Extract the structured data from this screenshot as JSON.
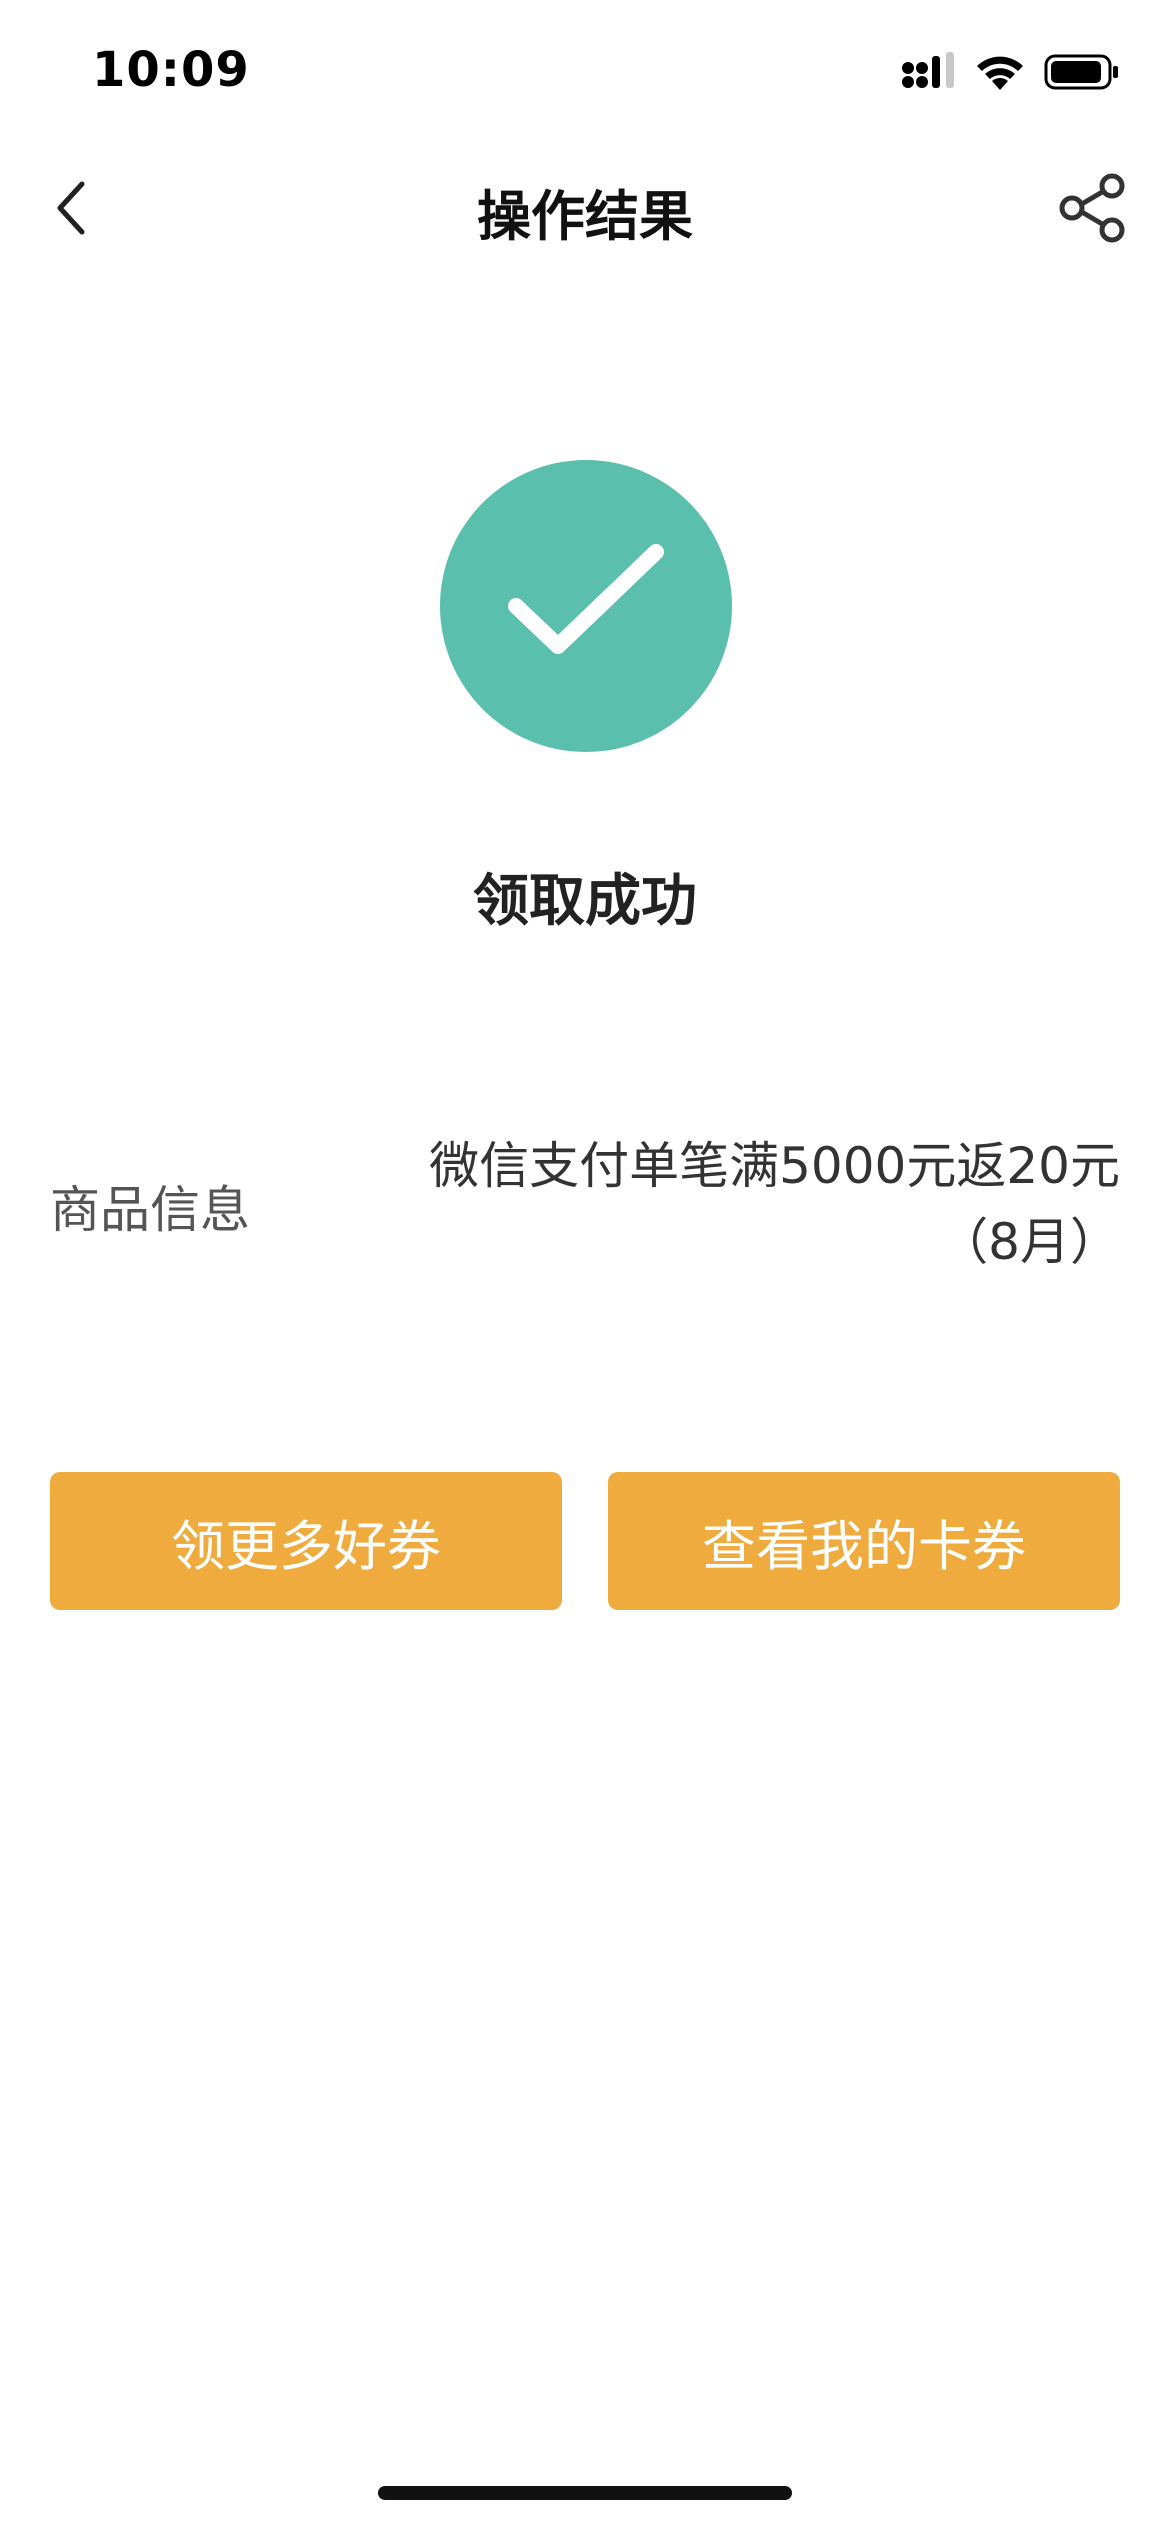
{
  "status_bar": {
    "time": "10:09"
  },
  "nav": {
    "title": "操作结果",
    "back_icon": "chevron-left-icon",
    "share_icon": "share-icon"
  },
  "result": {
    "icon": "check-circle-icon",
    "icon_color": "#5bbfae",
    "title": "领取成功"
  },
  "info": {
    "label": "商品信息",
    "value_line1": "微信支付单笔满5000元返20元",
    "value_line2": "（8月）"
  },
  "actions": {
    "more_coupons_label": "领更多好券",
    "view_coupons_label": "查看我的卡券",
    "button_color": "#efab3d"
  }
}
